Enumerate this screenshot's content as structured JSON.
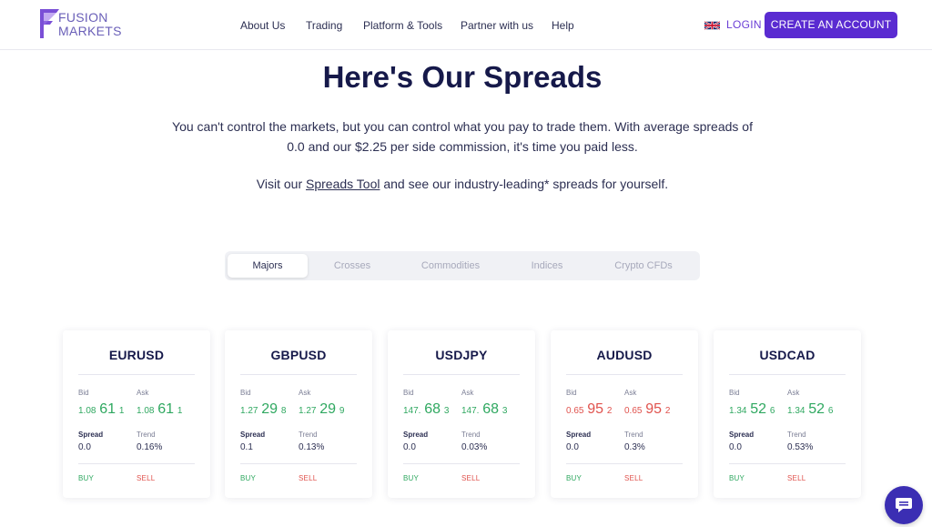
{
  "header": {
    "logo_line1": "FUSION",
    "logo_line2": "MARKETS",
    "nav": [
      "About Us",
      "Trading",
      "Platform & Tools",
      "Partner with us",
      "Help"
    ],
    "login": "LOGIN",
    "cta": "CREATE AN ACCOUNT"
  },
  "hero": {
    "title": "Here's Our Spreads",
    "intro": "You can't control the markets, but you can control what you pay to trade them. With average spreads of 0.0 and our $2.25 per side commission, it's time you paid less.",
    "visit_prefix": "Visit our ",
    "visit_link": "Spreads Tool",
    "visit_suffix": " and see our industry-leading* spreads for yourself."
  },
  "tabs": [
    "Majors",
    "Crosses",
    "Commodities",
    "Indices",
    "Crypto CFDs"
  ],
  "active_tab": "Majors",
  "labels": {
    "bid": "Bid",
    "ask": "Ask",
    "spread": "Spread",
    "trend": "Trend",
    "buy": "BUY",
    "sell": "SELL"
  },
  "cards": [
    {
      "symbol": "EURUSD",
      "color": "up",
      "bid": [
        "1.08",
        "61",
        "1"
      ],
      "ask": [
        "1.08",
        "61",
        "1"
      ],
      "spread": "0.0",
      "trend": "0.16%",
      "trend_color": "down"
    },
    {
      "symbol": "GBPUSD",
      "color": "up",
      "bid": [
        "1.27",
        "29",
        "8"
      ],
      "ask": [
        "1.27",
        "29",
        "9"
      ],
      "spread": "0.1",
      "trend": "0.13%",
      "trend_color": "up"
    },
    {
      "symbol": "USDJPY",
      "color": "up",
      "bid": [
        "147.",
        "68",
        "3"
      ],
      "ask": [
        "147.",
        "68",
        "3"
      ],
      "spread": "0.0",
      "trend": "0.03%",
      "trend_color": "up"
    },
    {
      "symbol": "AUDUSD",
      "color": "down",
      "bid": [
        "0.65",
        "95",
        "2"
      ],
      "ask": [
        "0.65",
        "95",
        "2"
      ],
      "spread": "0.0",
      "trend": "0.3%",
      "trend_color": "up"
    },
    {
      "symbol": "USDCAD",
      "color": "up",
      "bid": [
        "1.34",
        "52",
        "6"
      ],
      "ask": [
        "1.34",
        "52",
        "6"
      ],
      "spread": "0.0",
      "trend": "0.53%",
      "trend_color": "down"
    }
  ],
  "colors": {
    "brand": "#5a2bd1",
    "up": "#2fa860",
    "down": "#e0524d",
    "navy": "#16194a"
  },
  "icons": {
    "flag": "uk-flag-icon",
    "chat": "chat-bubble-icon"
  }
}
